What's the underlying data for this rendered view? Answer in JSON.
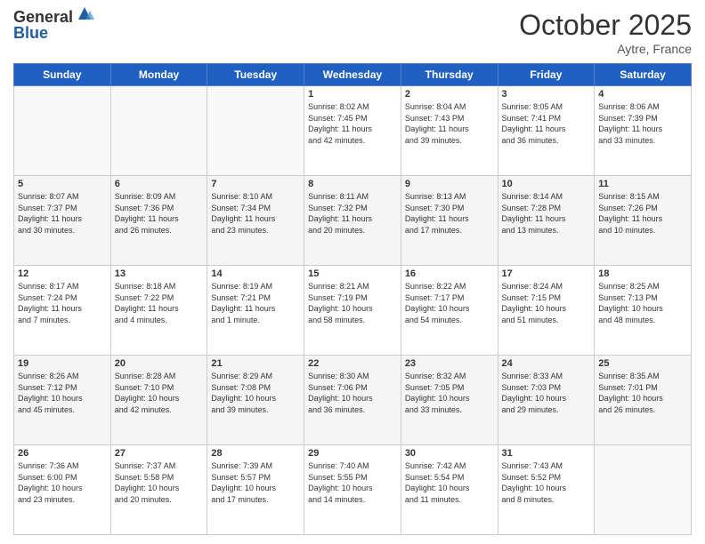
{
  "header": {
    "logo_general": "General",
    "logo_blue": "Blue",
    "month_title": "October 2025",
    "location": "Aytre, France"
  },
  "days_of_week": [
    "Sunday",
    "Monday",
    "Tuesday",
    "Wednesday",
    "Thursday",
    "Friday",
    "Saturday"
  ],
  "weeks": [
    [
      {
        "day": "",
        "info": ""
      },
      {
        "day": "",
        "info": ""
      },
      {
        "day": "",
        "info": ""
      },
      {
        "day": "1",
        "info": "Sunrise: 8:02 AM\nSunset: 7:45 PM\nDaylight: 11 hours\nand 42 minutes."
      },
      {
        "day": "2",
        "info": "Sunrise: 8:04 AM\nSunset: 7:43 PM\nDaylight: 11 hours\nand 39 minutes."
      },
      {
        "day": "3",
        "info": "Sunrise: 8:05 AM\nSunset: 7:41 PM\nDaylight: 11 hours\nand 36 minutes."
      },
      {
        "day": "4",
        "info": "Sunrise: 8:06 AM\nSunset: 7:39 PM\nDaylight: 11 hours\nand 33 minutes."
      }
    ],
    [
      {
        "day": "5",
        "info": "Sunrise: 8:07 AM\nSunset: 7:37 PM\nDaylight: 11 hours\nand 30 minutes."
      },
      {
        "day": "6",
        "info": "Sunrise: 8:09 AM\nSunset: 7:36 PM\nDaylight: 11 hours\nand 26 minutes."
      },
      {
        "day": "7",
        "info": "Sunrise: 8:10 AM\nSunset: 7:34 PM\nDaylight: 11 hours\nand 23 minutes."
      },
      {
        "day": "8",
        "info": "Sunrise: 8:11 AM\nSunset: 7:32 PM\nDaylight: 11 hours\nand 20 minutes."
      },
      {
        "day": "9",
        "info": "Sunrise: 8:13 AM\nSunset: 7:30 PM\nDaylight: 11 hours\nand 17 minutes."
      },
      {
        "day": "10",
        "info": "Sunrise: 8:14 AM\nSunset: 7:28 PM\nDaylight: 11 hours\nand 13 minutes."
      },
      {
        "day": "11",
        "info": "Sunrise: 8:15 AM\nSunset: 7:26 PM\nDaylight: 11 hours\nand 10 minutes."
      }
    ],
    [
      {
        "day": "12",
        "info": "Sunrise: 8:17 AM\nSunset: 7:24 PM\nDaylight: 11 hours\nand 7 minutes."
      },
      {
        "day": "13",
        "info": "Sunrise: 8:18 AM\nSunset: 7:22 PM\nDaylight: 11 hours\nand 4 minutes."
      },
      {
        "day": "14",
        "info": "Sunrise: 8:19 AM\nSunset: 7:21 PM\nDaylight: 11 hours\nand 1 minute."
      },
      {
        "day": "15",
        "info": "Sunrise: 8:21 AM\nSunset: 7:19 PM\nDaylight: 10 hours\nand 58 minutes."
      },
      {
        "day": "16",
        "info": "Sunrise: 8:22 AM\nSunset: 7:17 PM\nDaylight: 10 hours\nand 54 minutes."
      },
      {
        "day": "17",
        "info": "Sunrise: 8:24 AM\nSunset: 7:15 PM\nDaylight: 10 hours\nand 51 minutes."
      },
      {
        "day": "18",
        "info": "Sunrise: 8:25 AM\nSunset: 7:13 PM\nDaylight: 10 hours\nand 48 minutes."
      }
    ],
    [
      {
        "day": "19",
        "info": "Sunrise: 8:26 AM\nSunset: 7:12 PM\nDaylight: 10 hours\nand 45 minutes."
      },
      {
        "day": "20",
        "info": "Sunrise: 8:28 AM\nSunset: 7:10 PM\nDaylight: 10 hours\nand 42 minutes."
      },
      {
        "day": "21",
        "info": "Sunrise: 8:29 AM\nSunset: 7:08 PM\nDaylight: 10 hours\nand 39 minutes."
      },
      {
        "day": "22",
        "info": "Sunrise: 8:30 AM\nSunset: 7:06 PM\nDaylight: 10 hours\nand 36 minutes."
      },
      {
        "day": "23",
        "info": "Sunrise: 8:32 AM\nSunset: 7:05 PM\nDaylight: 10 hours\nand 33 minutes."
      },
      {
        "day": "24",
        "info": "Sunrise: 8:33 AM\nSunset: 7:03 PM\nDaylight: 10 hours\nand 29 minutes."
      },
      {
        "day": "25",
        "info": "Sunrise: 8:35 AM\nSunset: 7:01 PM\nDaylight: 10 hours\nand 26 minutes."
      }
    ],
    [
      {
        "day": "26",
        "info": "Sunrise: 7:36 AM\nSunset: 6:00 PM\nDaylight: 10 hours\nand 23 minutes."
      },
      {
        "day": "27",
        "info": "Sunrise: 7:37 AM\nSunset: 5:58 PM\nDaylight: 10 hours\nand 20 minutes."
      },
      {
        "day": "28",
        "info": "Sunrise: 7:39 AM\nSunset: 5:57 PM\nDaylight: 10 hours\nand 17 minutes."
      },
      {
        "day": "29",
        "info": "Sunrise: 7:40 AM\nSunset: 5:55 PM\nDaylight: 10 hours\nand 14 minutes."
      },
      {
        "day": "30",
        "info": "Sunrise: 7:42 AM\nSunset: 5:54 PM\nDaylight: 10 hours\nand 11 minutes."
      },
      {
        "day": "31",
        "info": "Sunrise: 7:43 AM\nSunset: 5:52 PM\nDaylight: 10 hours\nand 8 minutes."
      },
      {
        "day": "",
        "info": ""
      }
    ]
  ]
}
